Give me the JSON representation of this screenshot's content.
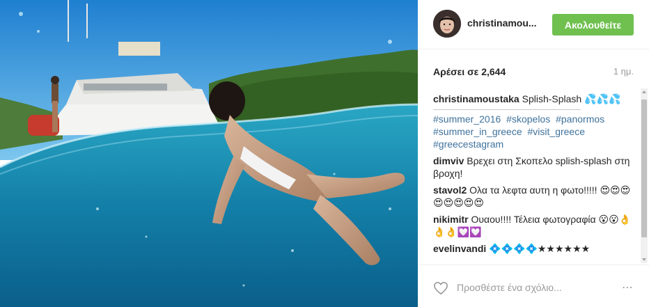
{
  "post": {
    "username": "christinamou...",
    "follow_label": "Ακολουθείτε",
    "likes_label": "Αρέσει σε 2,644",
    "time_ago": "1 ημ."
  },
  "caption": {
    "user": "christinamoustaka",
    "text": "Splish-Splash 💦💦💦",
    "hashtags": [
      "#summer_2016",
      "#skopelos",
      "#panormos",
      "#summer_in_greece",
      "#visit_greece",
      "#greecestagram"
    ]
  },
  "comments": [
    {
      "user": "dimviv",
      "text": "Βρεχει στη Σκοπελο splish-splash στη βροχη!"
    },
    {
      "user": "stavol2",
      "text": "Ολα τα λεφτα αυτη η φωτο!!!!! 😍😍😍😍😍😍😍😍"
    },
    {
      "user": "nikimitr",
      "text": "Ουαου!!!! Τέλεια φωτογραφία 😮😮👌👌👌💟💟"
    },
    {
      "user": "evelinvandi",
      "text": "💠💠💠💠★★★★★★"
    }
  ],
  "footer": {
    "comment_placeholder": "Προσθέστε ένα σχόλιο...",
    "more_label": "⋯"
  },
  "colors": {
    "follow_bg": "#70c050",
    "hashtag": "#3f729b",
    "sea": "#1f8fb6",
    "sky": "#2f95d8"
  },
  "icons": [
    "heart-icon",
    "more-options-icon"
  ]
}
